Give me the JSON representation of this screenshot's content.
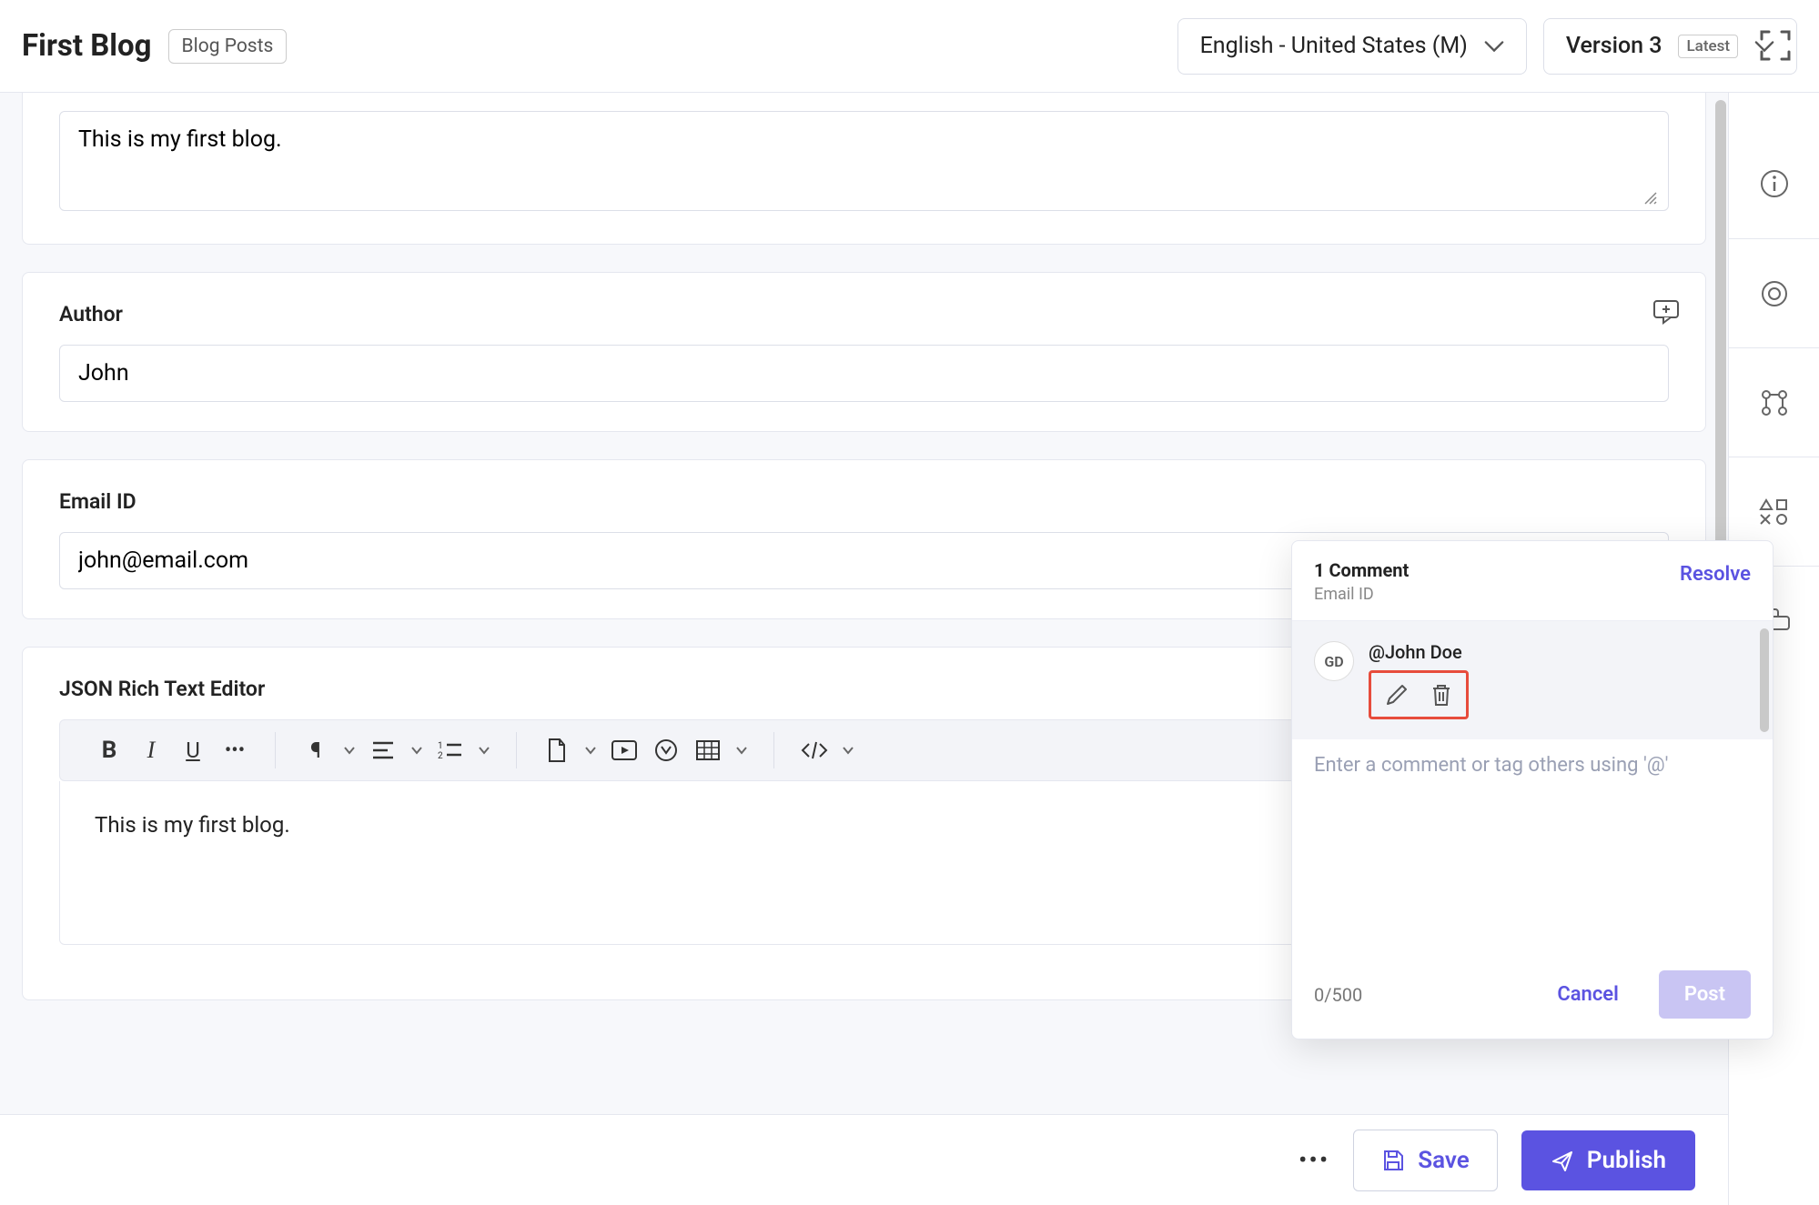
{
  "header": {
    "title": "First Blog",
    "badge": "Blog Posts",
    "locale": "English - United States (M)",
    "version_label": "Version 3",
    "version_badge": "Latest"
  },
  "fields": {
    "intro_value": "This is my first blog.",
    "author_label": "Author",
    "author_value": "John",
    "email_label": "Email ID",
    "email_value": "john@email.com",
    "rte_label": "JSON Rich Text Editor",
    "rte_body": "This is my first blog."
  },
  "comments": {
    "count_label": "1 Comment",
    "field_ref": "Email ID",
    "resolve": "Resolve",
    "avatar_initials": "GD",
    "mention": "@John Doe",
    "placeholder": "Enter a comment or tag others using '@'",
    "counter": "0/500",
    "cancel": "Cancel",
    "post": "Post"
  },
  "actions": {
    "save": "Save",
    "publish": "Publish"
  }
}
